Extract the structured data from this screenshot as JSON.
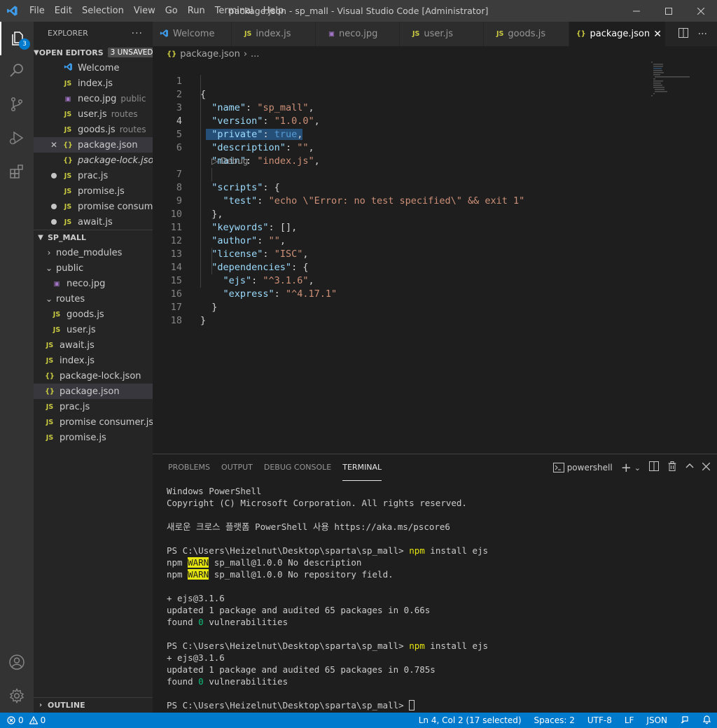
{
  "menu": [
    "File",
    "Edit",
    "Selection",
    "View",
    "Go",
    "Run",
    "Terminal",
    "Help"
  ],
  "window_title": "package.json - sp_mall - Visual Studio Code [Administrator]",
  "activity": {
    "explorer_badge": "3"
  },
  "sidebar": {
    "title": "EXPLORER",
    "open_editors": {
      "label": "OPEN EDITORS",
      "unsaved": "3 UNSAVED",
      "items": [
        {
          "name": "Welcome",
          "desc": "",
          "type": "vsc"
        },
        {
          "name": "index.js",
          "desc": "",
          "type": "js"
        },
        {
          "name": "neco.jpg",
          "desc": "public",
          "type": "img"
        },
        {
          "name": "user.js",
          "desc": "routes",
          "type": "js"
        },
        {
          "name": "goods.js",
          "desc": "routes",
          "type": "js"
        },
        {
          "name": "package.json",
          "desc": "",
          "type": "json"
        },
        {
          "name": "package-lock.json",
          "desc": "",
          "type": "json"
        },
        {
          "name": "prac.js",
          "desc": "",
          "type": "js"
        },
        {
          "name": "promise.js",
          "desc": "",
          "type": "js"
        },
        {
          "name": "promise consum...",
          "desc": "",
          "type": "js"
        },
        {
          "name": "await.js",
          "desc": "",
          "type": "js"
        }
      ]
    },
    "project": {
      "label": "SP_MALL",
      "items": [
        {
          "name": "node_modules",
          "type": "folder"
        },
        {
          "name": "public",
          "type": "folder"
        },
        {
          "name": "neco.jpg",
          "type": "img"
        },
        {
          "name": "routes",
          "type": "folder"
        },
        {
          "name": "goods.js",
          "type": "js"
        },
        {
          "name": "user.js",
          "type": "js"
        },
        {
          "name": "await.js",
          "type": "js"
        },
        {
          "name": "index.js",
          "type": "js"
        },
        {
          "name": "package-lock.json",
          "type": "json"
        },
        {
          "name": "package.json",
          "type": "json"
        },
        {
          "name": "prac.js",
          "type": "js"
        },
        {
          "name": "promise consumer.js",
          "type": "js"
        },
        {
          "name": "promise.js",
          "type": "js"
        }
      ]
    },
    "outline_label": "OUTLINE"
  },
  "icons": {
    "js": "JS",
    "json": "{}",
    "img": "▣"
  },
  "tabs": [
    {
      "label": "Welcome",
      "type": "vsc"
    },
    {
      "label": "index.js",
      "type": "js"
    },
    {
      "label": "neco.jpg",
      "type": "img"
    },
    {
      "label": "user.js",
      "type": "js"
    },
    {
      "label": "goods.js",
      "type": "js"
    },
    {
      "label": "package.json",
      "type": "json"
    }
  ],
  "editor": {
    "breadcrumb_file": "package.json",
    "breadcrumb_more": "...",
    "codelens": "▷ Debug",
    "line_numbers": [
      "1",
      "2",
      "3",
      "4",
      "5",
      "6",
      "7",
      "8",
      "9",
      "10",
      "11",
      "12",
      "13",
      "14",
      "15",
      "16",
      "17",
      "18"
    ],
    "code": {
      "l1": "{",
      "l2_key": "\"name\"",
      "l2_val": "\"sp_mall\"",
      "l3_key": "\"version\"",
      "l3_val": "\"1.0.0\"",
      "l4_key": "\"private\"",
      "l4_val": "true",
      "l5_key": "\"description\"",
      "l5_val": "\"\"",
      "l6_key": "\"main\"",
      "l6_val": "\"index.js\"",
      "l7_key": "\"scripts\"",
      "l8_key": "\"test\"",
      "l8_val": "\"echo \\\"Error: no test specified\\\" && exit 1\"",
      "l9": "},",
      "l10_key": "\"keywords\"",
      "l10_val": "[]",
      "l11_key": "\"author\"",
      "l11_val": "\"\"",
      "l12_key": "\"license\"",
      "l12_val": "\"ISC\"",
      "l13_key": "\"dependencies\"",
      "l14_key": "\"ejs\"",
      "l14_val": "\"^3.1.6\"",
      "l15_key": "\"express\"",
      "l15_val": "\"^4.17.1\"",
      "l16": "}",
      "l17": "}"
    }
  },
  "panel": {
    "tabs": [
      "PROBLEMS",
      "OUTPUT",
      "DEBUG CONSOLE",
      "TERMINAL"
    ],
    "shell": "powershell",
    "terminal": {
      "t1": "Windows PowerShell",
      "t2": "Copyright (C) Microsoft Corporation. All rights reserved.",
      "t3": "새로운 크로스 플랫폼 PowerShell 사용 https://aka.ms/pscore6",
      "prompt": "PS C:\\Users\\Heizelnut\\Desktop\\sparta\\sp_mall> ",
      "cmd_npm": "npm",
      "cmd_rest": " install ejs",
      "npm": "npm ",
      "warn": "WARN",
      "warn1": " sp_mall@1.0.0 No description",
      "warn2": " sp_mall@1.0.0 No repository field.",
      "added": "+ ejs@3.1.6",
      "updated1": "updated 1 package and audited 65 packages in 0.66s",
      "updated2": "updated 1 package and audited 65 packages in 0.785s",
      "found": "found ",
      "zero": "0",
      "vuln": " vulnerabilities"
    }
  },
  "statusbar": {
    "errors": "0",
    "warnings": "0",
    "position": "Ln 4, Col 2 (17 selected)",
    "spaces": "Spaces: 2",
    "encoding": "UTF-8",
    "eol": "LF",
    "language": "JSON"
  },
  "colors": {
    "accent": "#007acc",
    "activity": "#333333",
    "sidebar": "#252526",
    "editor": "#1e1e1e"
  }
}
